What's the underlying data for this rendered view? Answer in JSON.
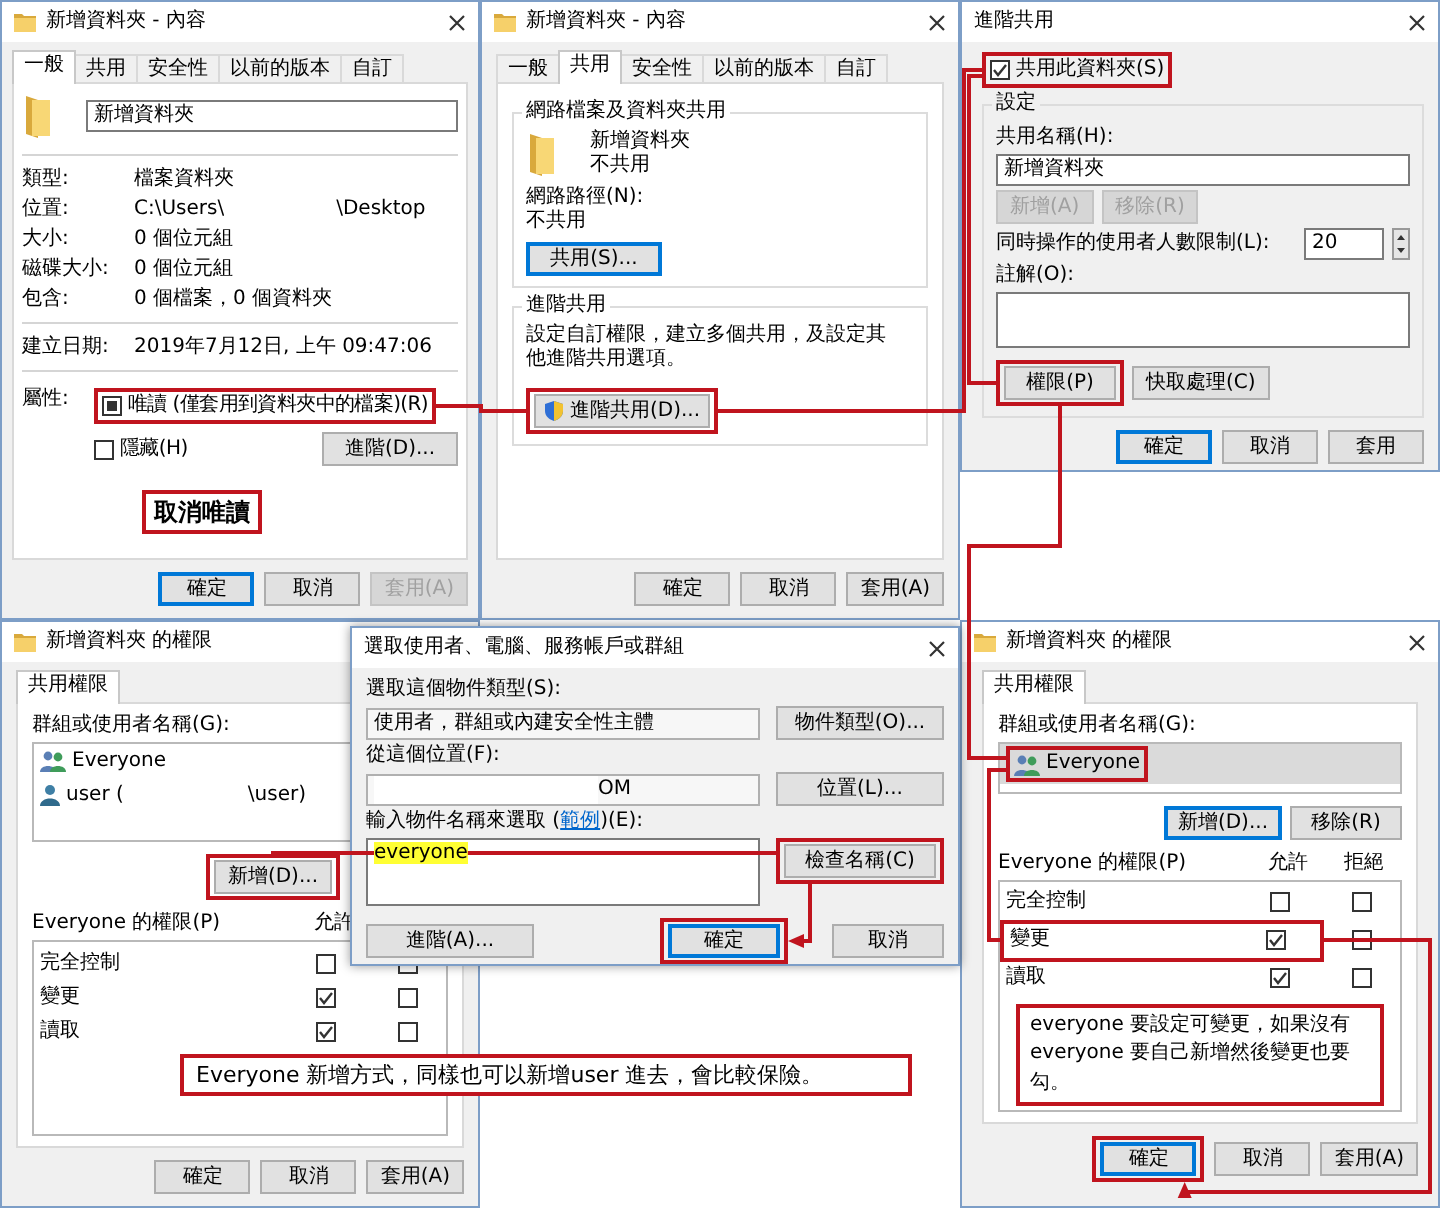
{
  "general_dialog": {
    "title": "新增資料夾 - 內容",
    "tabs": [
      {
        "label": "一般",
        "selected": true
      },
      {
        "label": "共用",
        "selected": false
      },
      {
        "label": "安全性",
        "selected": false
      },
      {
        "label": "以前的版本",
        "selected": false
      },
      {
        "label": "自訂",
        "selected": false
      }
    ],
    "folder_name": "新增資料夾",
    "details": [
      {
        "label": "類型:",
        "value": "檔案資料夾"
      },
      {
        "label": "位置:",
        "value": "C:\\Users\\",
        "value_tail": "\\Desktop"
      },
      {
        "label": "大小:",
        "value": "0 個位元組"
      },
      {
        "label": "磁碟大小:",
        "value": "0 個位元組"
      },
      {
        "label": "包含:",
        "value": "0 個檔案，0 個資料夾"
      }
    ],
    "created": {
      "label": "建立日期:",
      "value": "2019年7月12日, 上午 09:47:06"
    },
    "attributes_label": "屬性:",
    "attributes": [
      {
        "label": "唯讀 (僅套用到資料夾中的檔案)(R)",
        "checked": false,
        "indeterminate": true,
        "highlighted": true
      },
      {
        "label": "隱藏(H)",
        "checked": false,
        "indeterminate": false,
        "highlighted": false
      }
    ],
    "advanced_button": "進階(D)...",
    "note": "取消唯讀",
    "buttons": [
      {
        "label": "確定",
        "default": true,
        "disabled": false
      },
      {
        "label": "取消",
        "default": false,
        "disabled": false
      },
      {
        "label": "套用(A)",
        "default": false,
        "disabled": true
      }
    ]
  },
  "sharing_tab_dialog": {
    "title": "新增資料夾 - 內容",
    "tabs": [
      {
        "label": "一般",
        "selected": false
      },
      {
        "label": "共用",
        "selected": true
      },
      {
        "label": "安全性",
        "selected": false
      },
      {
        "label": "以前的版本",
        "selected": false
      },
      {
        "label": "自訂",
        "selected": false
      }
    ],
    "network_group": {
      "title": "網路檔案及資料夾共用",
      "folder_name": "新增資料夾",
      "status": "不共用",
      "path_label": "網路路徑(N):",
      "path": "不共用",
      "share_button": {
        "label": "共用(S)...",
        "default": true
      }
    },
    "advanced_group": {
      "title": "進階共用",
      "description": "設定自訂權限，建立多個共用，及設定其他進階共用選項。",
      "button": {
        "label": "進階共用(D)...",
        "highlighted": true
      }
    },
    "buttons": [
      {
        "label": "確定",
        "default": false,
        "disabled": false
      },
      {
        "label": "取消",
        "default": false,
        "disabled": false
      },
      {
        "label": "套用(A)",
        "default": false,
        "disabled": false
      }
    ]
  },
  "advanced_sharing_dialog": {
    "title": "進階共用",
    "share_checkbox": {
      "label": "共用此資料夾(S)",
      "checked": true,
      "highlighted": true
    },
    "settings_group": {
      "title": "設定",
      "share_name_label": "共用名稱(H):",
      "share_name": "新增資料夾",
      "name_buttons": [
        {
          "label": "新增(A)",
          "disabled": true
        },
        {
          "label": "移除(R)",
          "disabled": true
        }
      ],
      "user_limit_label": "同時操作的使用者人數限制(L):",
      "user_limit": "20",
      "comment_label": "註解(O):",
      "action_buttons": [
        {
          "label": "權限(P)",
          "highlighted": true
        },
        {
          "label": "快取處理(C)",
          "highlighted": false
        }
      ]
    },
    "buttons": [
      {
        "label": "確定",
        "default": true,
        "disabled": false
      },
      {
        "label": "取消",
        "default": false,
        "disabled": false
      },
      {
        "label": "套用",
        "default": false,
        "disabled": false
      }
    ]
  },
  "permissions_dialog_left": {
    "title": "新增資料夾 的權限",
    "tabs": [
      {
        "label": "共用權限",
        "selected": true
      }
    ],
    "names_label": "群組或使用者名稱(G):",
    "principals": [
      {
        "kind": "group",
        "name": "Everyone",
        "selected": false,
        "highlighted": false
      },
      {
        "kind": "user",
        "name": "user (",
        "name_tail": "\\user)",
        "selected": false,
        "highlighted": false
      }
    ],
    "add_button": {
      "label": "新增(D)...",
      "highlighted": true
    },
    "permissions_label": "Everyone 的權限(P)",
    "allow_header": "允許",
    "permissions": [
      {
        "name": "完全控制",
        "allow": false,
        "deny": false,
        "highlighted": false
      },
      {
        "name": "變更",
        "allow": true,
        "deny": false,
        "highlighted": false
      },
      {
        "name": "讀取",
        "allow": true,
        "deny": false,
        "highlighted": false
      }
    ],
    "buttons": [
      {
        "label": "確定",
        "default": false,
        "disabled": false
      },
      {
        "label": "取消",
        "default": false,
        "disabled": false
      },
      {
        "label": "套用(A)",
        "default": false,
        "disabled": false
      }
    ]
  },
  "select_users_dialog": {
    "title": "選取使用者、電腦、服務帳戶或群組",
    "object_type_label": "選取這個物件類型(S):",
    "object_type": "使用者，群組或內建安全性主體",
    "object_type_button": "物件類型(O)...",
    "location_label": "從這個位置(F):",
    "location": "OM",
    "location_button": "位置(L)...",
    "names_label_before": "輸入物件名稱來選取 (",
    "names_link": "範例",
    "names_label_after": ")(E):",
    "names_value": "everyone",
    "names_value_marked": true,
    "check_names_button": {
      "label": "檢查名稱(C)",
      "highlighted": true
    },
    "advanced_button": "進階(A)...",
    "buttons": [
      {
        "label": "確定",
        "default": true,
        "highlighted": true
      },
      {
        "label": "取消",
        "default": false,
        "highlighted": false
      }
    ]
  },
  "permissions_dialog_right": {
    "title": "新增資料夾 的權限",
    "tabs": [
      {
        "label": "共用權限",
        "selected": true
      }
    ],
    "names_label": "群組或使用者名稱(G):",
    "principals": [
      {
        "kind": "group",
        "name": "Everyone",
        "selected": true,
        "highlighted": true
      }
    ],
    "add_button": {
      "label": "新增(D)...",
      "highlighted": false
    },
    "remove_button": "移除(R)",
    "permissions_label": "Everyone 的權限(P)",
    "allow_header": "允許",
    "deny_header": "拒絕",
    "permissions": [
      {
        "name": "完全控制",
        "allow": false,
        "deny": false,
        "highlighted": false
      },
      {
        "name": "變更",
        "allow": true,
        "deny": false,
        "highlighted": true
      },
      {
        "name": "讀取",
        "allow": true,
        "deny": false,
        "highlighted": false
      }
    ],
    "note": "everyone 要設定可變更，如果沒有everyone 要自己新增然後變更也要勾。",
    "buttons": [
      {
        "label": "確定",
        "default": true,
        "disabled": false,
        "highlighted": true
      },
      {
        "label": "取消",
        "default": false,
        "disabled": false
      },
      {
        "label": "套用(A)",
        "default": false,
        "disabled": false
      }
    ]
  },
  "bottom_note": "Everyone 新增方式，同樣也可以新增user 進去，會比較保險。"
}
